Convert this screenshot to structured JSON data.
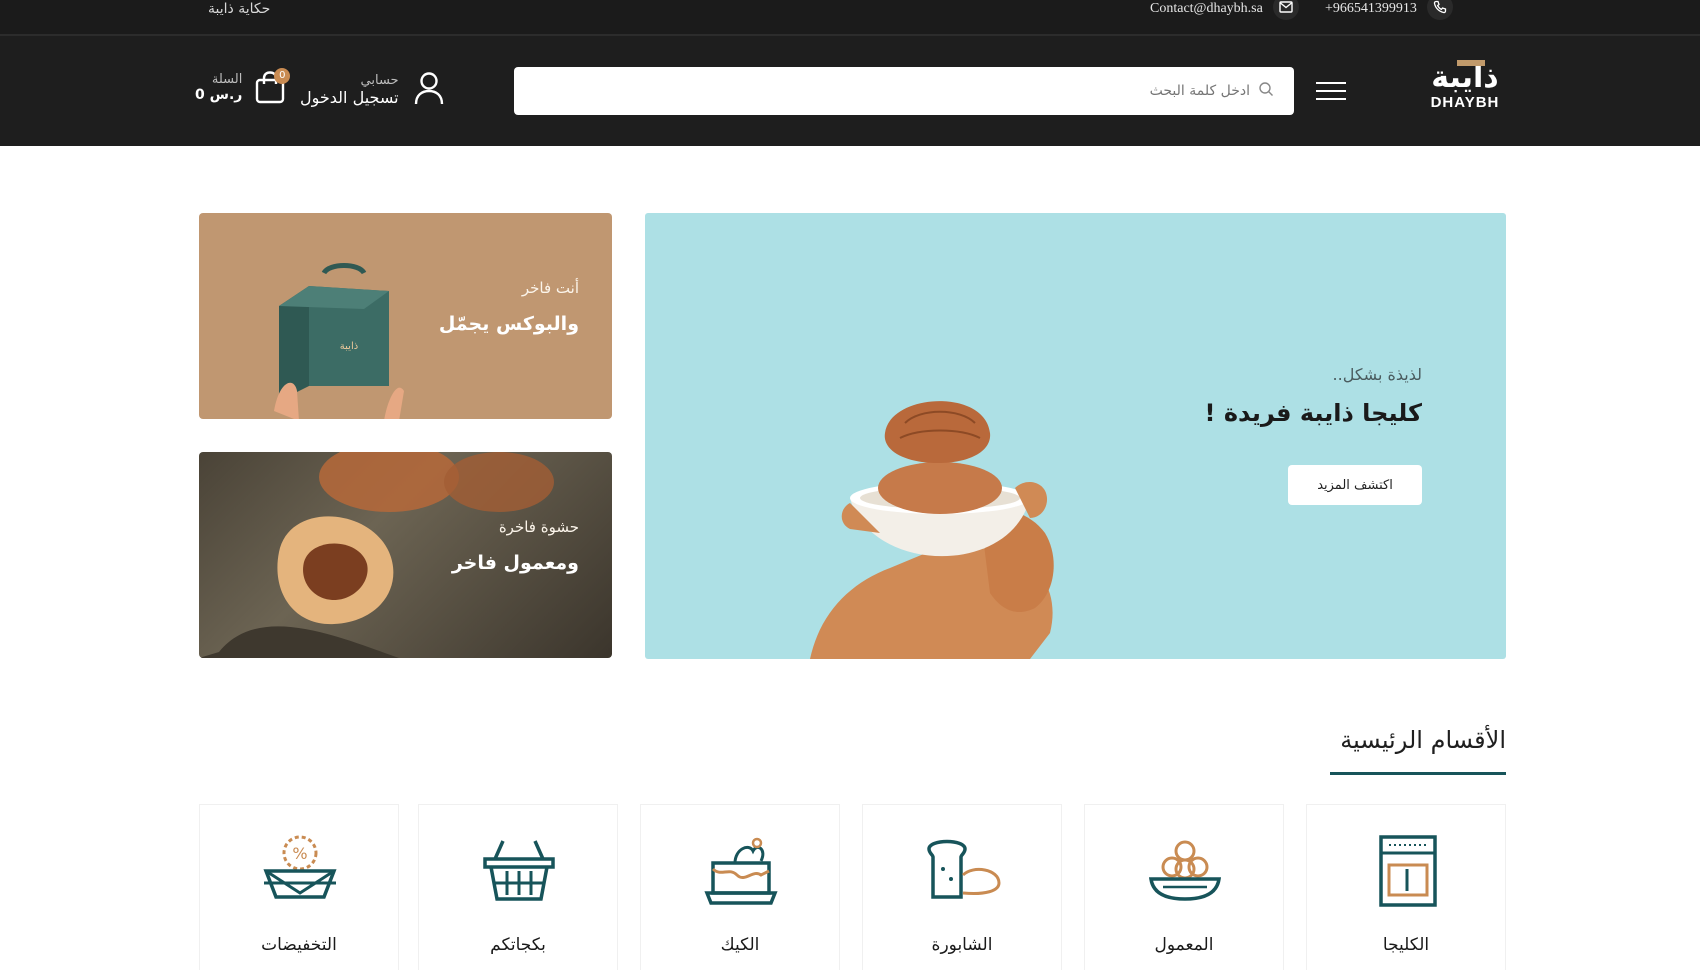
{
  "topbar": {
    "story_link": "حكاية ذايبة",
    "email": "Contact@dhaybh.sa",
    "phone": "+966541399913"
  },
  "header": {
    "logo_ar": "ذايبة",
    "logo_en": "DHAYBH",
    "search_placeholder": "ادخل كلمة البحث",
    "account_small": "حسابي",
    "account_big": "تسجيل الدخول",
    "cart_small": "السلة",
    "cart_total": "0 ر.س",
    "cart_count": "0"
  },
  "hero": {
    "pretitle": "لذيذة بشكل..",
    "title": "كليجا ذايبة فريدة !",
    "cta": "اكتشف المزيد"
  },
  "promos": [
    {
      "sub": "أنت فاخر",
      "head": "والبوكس يجمّل"
    },
    {
      "sub": "حشوة فاخرة",
      "head": "ومعمول فاخر"
    }
  ],
  "section": {
    "title": "الأقسام الرئيسية"
  },
  "categories": [
    {
      "label": "الكليجا",
      "icon": "kleija-icon"
    },
    {
      "label": "المعمول",
      "icon": "maamoul-icon"
    },
    {
      "label": "الشابورة",
      "icon": "shaboura-icon"
    },
    {
      "label": "الكيك",
      "icon": "cake-icon"
    },
    {
      "label": "بكجاتكم",
      "icon": "basket-icon"
    },
    {
      "label": "التخفيضات",
      "icon": "discount-icon"
    }
  ],
  "colors": {
    "dark_bar": "#1b1b1b",
    "hero_bg": "#ade0e5",
    "accent_teal": "#17545a",
    "accent_gold": "#c98b52"
  }
}
